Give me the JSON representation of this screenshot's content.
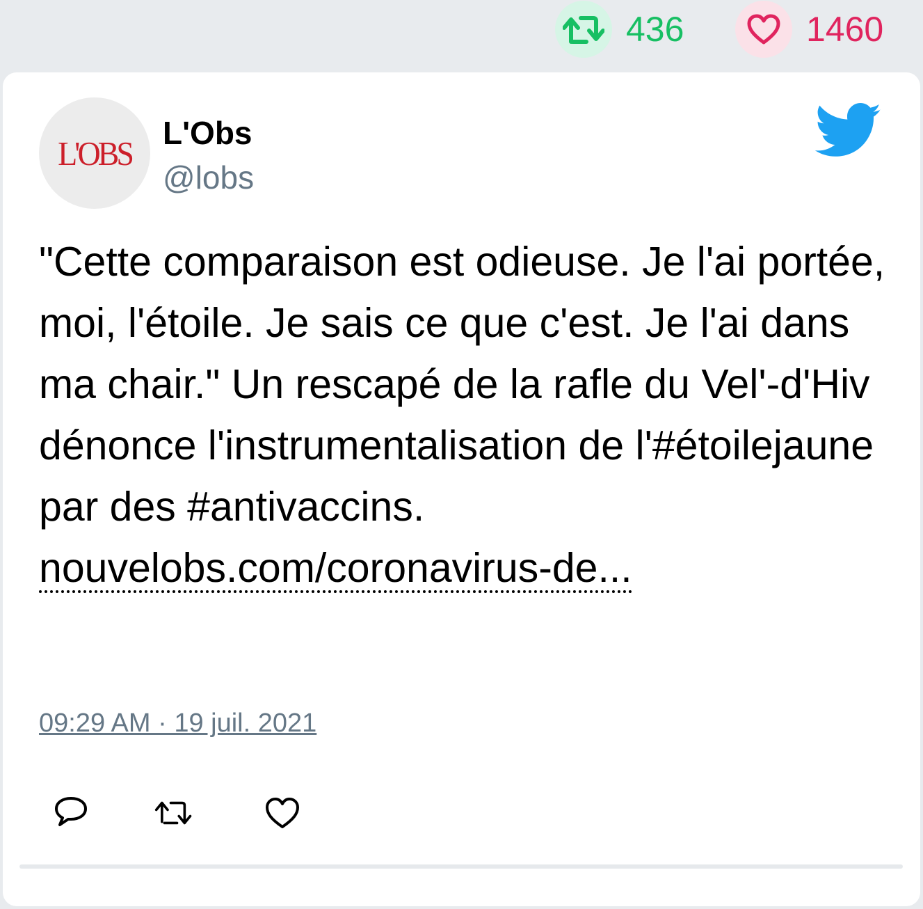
{
  "stats": {
    "retweets": "436",
    "likes": "1460",
    "retweet_color": "#17bf63",
    "like_color": "#e0245e"
  },
  "author": {
    "avatar_logo_text": "L'OBS",
    "name": "L'Obs",
    "handle": "@lobs"
  },
  "tweet": {
    "text": "\"Cette comparaison est odieuse. Je l'ai portée, moi, l'étoile. Je sais ce que c'est. Je l'ai dans ma chair.\" Un rescapé de la rafle du Vel'-d'Hiv dénonce l'instrumentalisation de l'#étoilejaune par des #antivaccins.",
    "link_text": "nouvelobs.com/coronavirus-de...",
    "timestamp": "09:29 AM · 19 juil. 2021"
  },
  "icons": {
    "brand": "twitter-bird-icon",
    "brand_color": "#1da1f2",
    "actions": [
      "reply-icon",
      "retweet-icon",
      "like-icon"
    ]
  }
}
